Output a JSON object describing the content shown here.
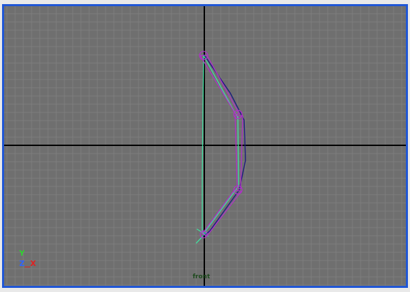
{
  "viewport": {
    "view_label": "front",
    "colors": {
      "background": "#6f6f6f",
      "grid": "#7d7d7d",
      "origin_axes": "#000000",
      "border_active": "#1f56d6",
      "bone": "#b030c8",
      "ik_handle": "#40e0a0",
      "curve": "#1a1a80"
    }
  },
  "axis_indicator": {
    "y_label": "Y",
    "z_label": "Z",
    "x_label": "X",
    "colors": {
      "y": "#2fd22f",
      "z": "#2e64ff",
      "x": "#e02020"
    }
  }
}
